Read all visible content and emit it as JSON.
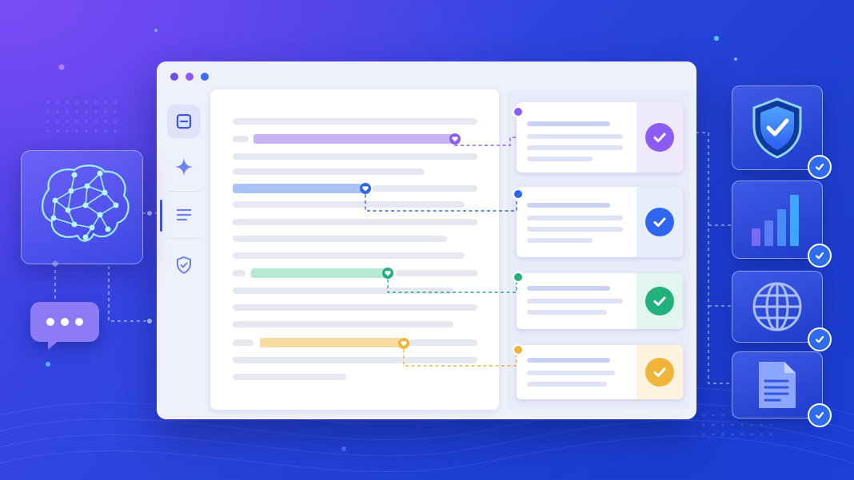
{
  "window": {
    "traffic_lights": [
      {
        "name": "window-dot-1",
        "color": "#6a4fe8"
      },
      {
        "name": "window-dot-2",
        "color": "#8b5cf6"
      },
      {
        "name": "window-dot-3",
        "color": "#3b6ef5"
      }
    ],
    "sidebar": [
      {
        "name": "sidebar-item-document",
        "icon": "document-box-icon",
        "active": true
      },
      {
        "name": "sidebar-item-ai",
        "icon": "sparkle-icon",
        "active": false
      },
      {
        "name": "sidebar-item-list",
        "icon": "list-lines-icon",
        "active": false
      },
      {
        "name": "sidebar-item-security",
        "icon": "shield-check-icon",
        "active": false
      }
    ]
  },
  "highlights": [
    {
      "name": "highlight-purple",
      "color": "#c6b4f5",
      "marker": "#8b5cf6"
    },
    {
      "name": "highlight-blue",
      "color": "#a9c2f5",
      "marker": "#2f66f0"
    },
    {
      "name": "highlight-green",
      "color": "#b6e8d3",
      "marker": "#22b07d"
    },
    {
      "name": "highlight-yellow",
      "color": "#f5dba0",
      "marker": "#f0b43a"
    }
  ],
  "result_cards": [
    {
      "name": "result-card-purple",
      "accent": "#8b5cf6",
      "tint": "#efe9fd",
      "check_color": "#8b5cf6"
    },
    {
      "name": "result-card-blue",
      "accent": "#2f66f0",
      "tint": "#e6eefd",
      "check_color": "#2f66f0"
    },
    {
      "name": "result-card-green",
      "accent": "#22b07d",
      "tint": "#e2f6ee",
      "check_color": "#22b07d"
    },
    {
      "name": "result-card-yellow",
      "accent": "#f0b43a",
      "tint": "#fdf3de",
      "check_color": "#f0b43a"
    }
  ],
  "left_widgets": {
    "brain": {
      "icon": "brain-network-icon"
    },
    "chat": {
      "icon": "chat-bubble-icon"
    }
  },
  "right_tiles": [
    {
      "name": "security-tile",
      "icon": "shield-check-icon",
      "badge": "check-badge-icon"
    },
    {
      "name": "analytics-tile",
      "icon": "bar-chart-icon",
      "badge": "check-badge-icon"
    },
    {
      "name": "globe-tile",
      "icon": "globe-icon",
      "badge": "check-badge-icon"
    },
    {
      "name": "document-tile",
      "icon": "document-icon",
      "badge": "check-badge-icon"
    }
  ],
  "colors": {
    "background_start": "#6a3df0",
    "background_end": "#1a35b8",
    "window_bg": "#eef0fb",
    "connector_light": "#b8c6ff"
  }
}
